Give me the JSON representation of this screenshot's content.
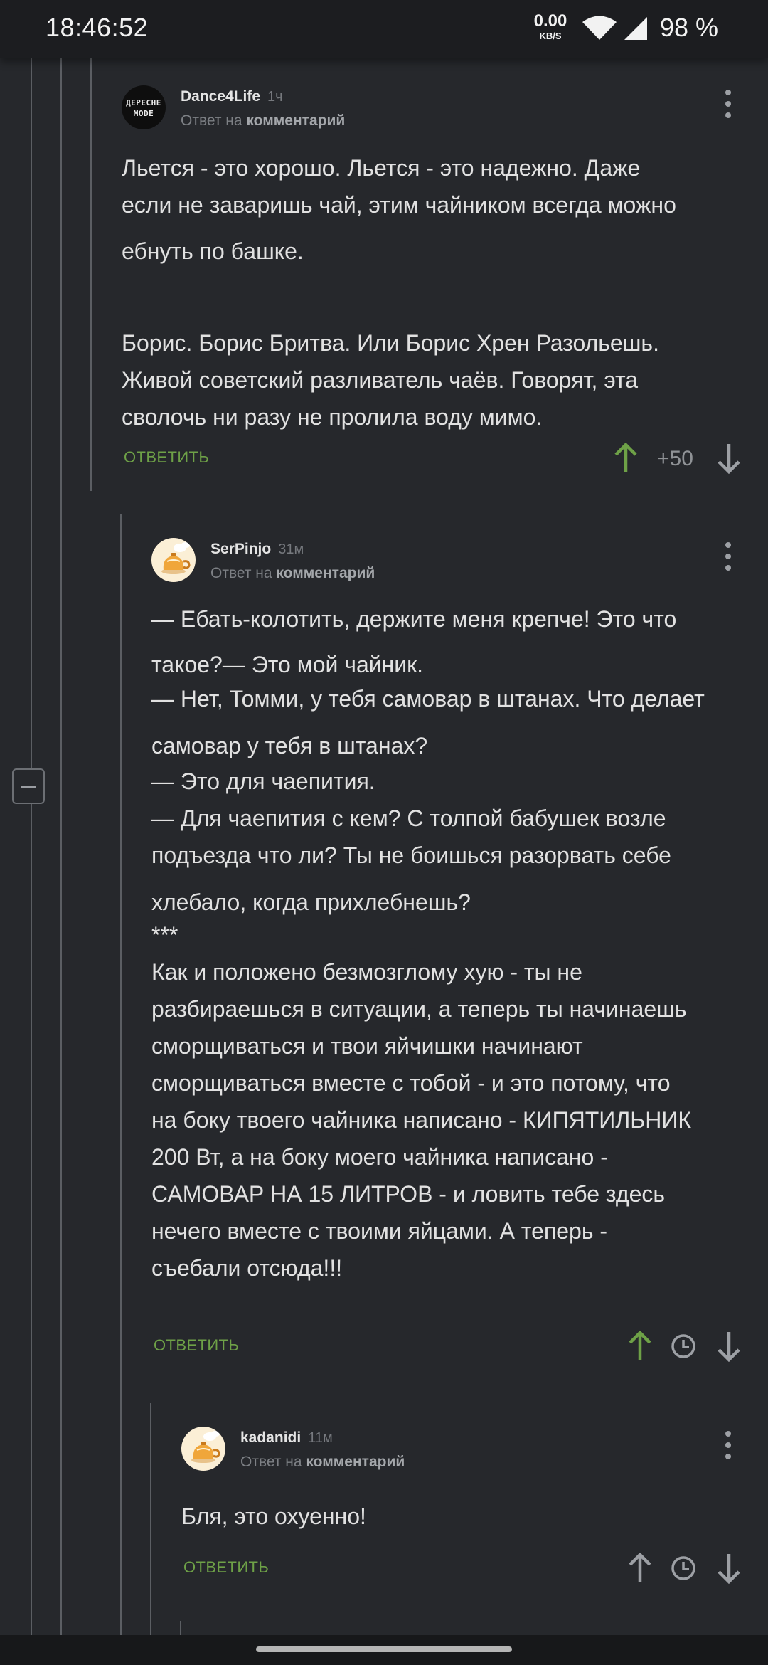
{
  "status_bar": {
    "time": "18:46:52",
    "net_speed": "0.00",
    "net_unit": "KB/S",
    "battery": "98 %",
    "icons": [
      "wifi-icon",
      "cellular-signal-icon"
    ]
  },
  "colors": {
    "background": "#26282c",
    "reply_link": "#6ea147",
    "upvote_active": "#6ea147",
    "text": "#e1e1e1"
  },
  "comments": [
    {
      "author": "Dance4Life",
      "avatar_text": [
        "ДEPECHE",
        "MODE"
      ],
      "time": "1ч",
      "reply_prefix": "Ответ на",
      "reply_target": "комментарий",
      "body": [
        "Льется - это хорошо. Льется - это надежно. Даже",
        "если не заваришь чай, этим чайником всегда можно",
        "ебнуть по башке.",
        "",
        "Борис. Борис Бритва. Или Борис Хрен Разольешь.",
        "Живой советский разливатель чаёв. Говорят, эта",
        "сволочь ни разу не пролила воду мимо."
      ],
      "reply_label": "ОТВЕТИТЬ",
      "score": "+50",
      "upvoted": true
    },
    {
      "author": "SerPinjo",
      "time": "31м",
      "reply_prefix": "Ответ на",
      "reply_target": "комментарий",
      "body": [
        "— Ебать-колотить, держите меня крепче! Это что",
        "такое?— Это мой чайник.",
        "— Нет, Томми, у тебя самовар в штанах. Что делает",
        "самовар у тебя в штанах?",
        "— Это для чаепития.",
        "— Для чаепития с кем? С толпой бабушек возле",
        "подъезда что ли? Ты не боишься разорвать себе",
        "хлебало, когда прихлебнешь?",
        "***",
        "Как и положено безмозглому хую - ты не",
        "разбираешься в ситуации, а теперь ты начинаешь",
        "сморщиваться и твои яйчишки начинают",
        "сморщиваться вместе с тобой - и это потому, что",
        "на боку твоего чайника написано - КИПЯТИЛЬНИК",
        "200 Вт, а на боку моего чайника написано -",
        "САМОВАР НА 15 ЛИТРОВ - и ловить тебе здесь",
        "нечего вместе с твоими яйцами. А теперь -",
        "съебали отсюда!!!"
      ],
      "reply_label": "ОТВЕТИТЬ",
      "upvoted": true
    },
    {
      "author": "kadanidi",
      "time": "11м",
      "reply_prefix": "Ответ на",
      "reply_target": "комментарий",
      "body": [
        "Бля, это охуенно!"
      ],
      "reply_label": "ОТВЕТИТЬ",
      "upvoted": false
    }
  ]
}
